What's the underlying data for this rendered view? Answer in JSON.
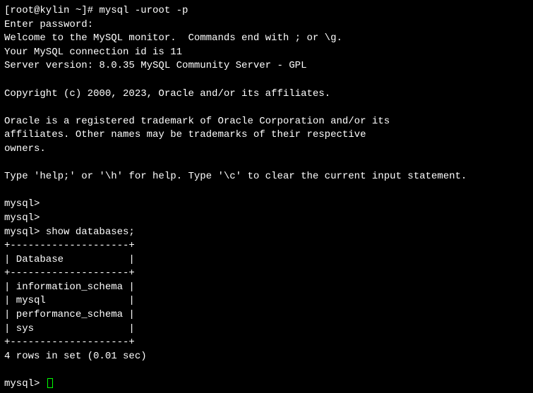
{
  "shell_prompt": "[root@kylin ~]# ",
  "shell_command": "mysql -uroot -p",
  "password_prompt": "Enter password:",
  "welcome_line": "Welcome to the MySQL monitor.  Commands end with ; or \\g.",
  "connection_line": "Your MySQL connection id is 11",
  "version_line": "Server version: 8.0.35 MySQL Community Server - GPL",
  "copyright_line": "Copyright (c) 2000, 2023, Oracle and/or its affiliates.",
  "trademark_line1": "Oracle is a registered trademark of Oracle Corporation and/or its",
  "trademark_line2": "affiliates. Other names may be trademarks of their respective",
  "trademark_line3": "owners.",
  "help_line": "Type 'help;' or '\\h' for help. Type '\\c' to clear the current input statement.",
  "mysql_prompt": "mysql> ",
  "sql_command": "show databases;",
  "table_border_top": "+--------------------+",
  "table_header": "| Database           |",
  "table_border_mid": "+--------------------+",
  "table_row1": "| information_schema |",
  "table_row2": "| mysql              |",
  "table_row3": "| performance_schema |",
  "table_row4": "| sys                |",
  "table_border_bottom": "+--------------------+",
  "result_summary": "4 rows in set (0.01 sec)",
  "databases": [
    "information_schema",
    "mysql",
    "performance_schema",
    "sys"
  ]
}
